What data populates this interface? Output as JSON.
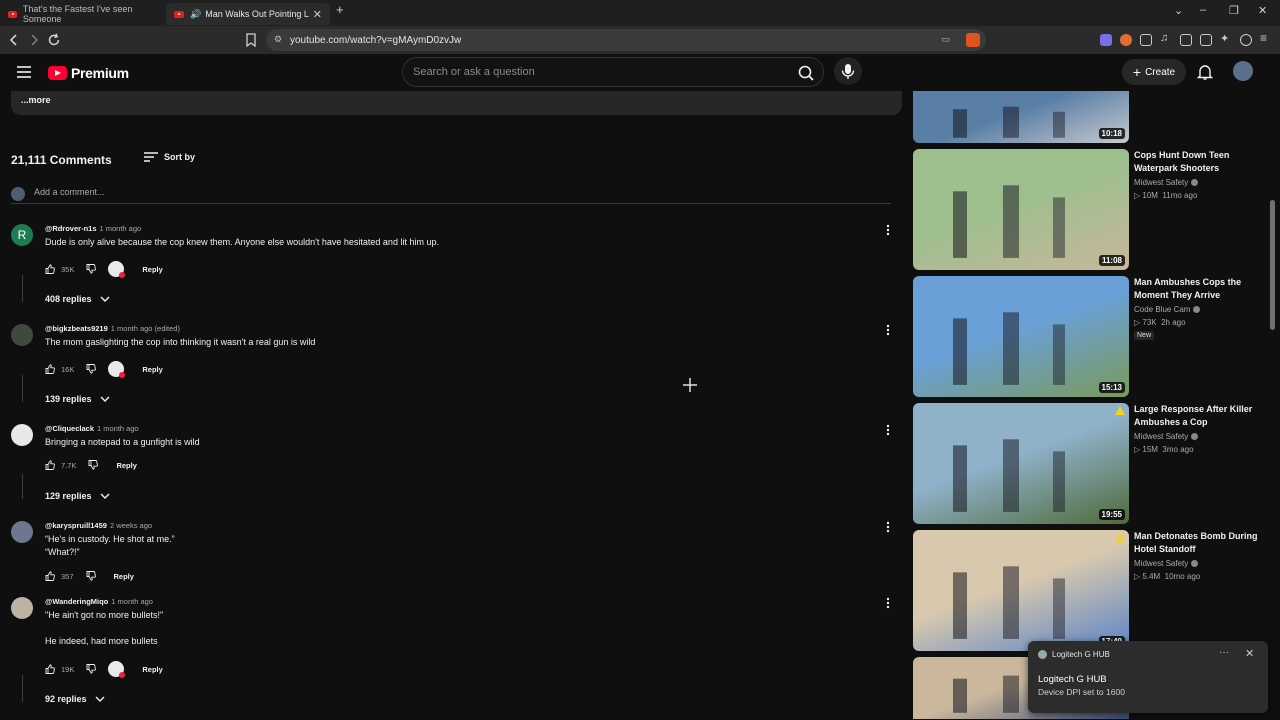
{
  "browser": {
    "tabs": [
      {
        "title": "That's the Fastest I've seen Someone"
      },
      {
        "title": "Man Walks Out Pointing Load"
      }
    ],
    "url": "youtube.com/watch?v=gMAymD0zvJw"
  },
  "header": {
    "logo": "Premium",
    "search_placeholder": "Search or ask a question",
    "create_label": "Create"
  },
  "description": {
    "more_label": "...more"
  },
  "comments": {
    "count_label": "21,111 Comments",
    "sort_label": "Sort by",
    "add_placeholder": "Add a comment...",
    "reply_label": "Reply",
    "items": [
      {
        "avatar_letter": "R",
        "avatar_color": "#1e7c53",
        "handle": "@Rdrover-n1s",
        "time": "1 month ago",
        "lines": [
          "Dude is only alive because the cop knew them.  Anyone else wouldn't have hesitated and lit him up."
        ],
        "likes": "35K",
        "creator_heart": true,
        "replies": "408 replies"
      },
      {
        "avatar_letter": "",
        "avatar_color": "#3f4a3c",
        "handle": "@bigkzbeats9219",
        "time": "1 month ago (edited)",
        "lines": [
          "The mom gaslighting the cop into thinking it wasn't a real gun is wild"
        ],
        "likes": "16K",
        "creator_heart": true,
        "replies": "139 replies"
      },
      {
        "avatar_letter": "",
        "avatar_color": "#e8e8e8",
        "handle": "@Cliqueclack",
        "time": "1 month ago",
        "lines": [
          "Bringing a notepad to a gunfight is wild"
        ],
        "likes": "7.7K",
        "creator_heart": false,
        "replies": "129 replies"
      },
      {
        "avatar_letter": "",
        "avatar_color": "#6d7890",
        "handle": "@karyspruill1459",
        "time": "2 weeks ago",
        "lines": [
          "“He's in custody. He shot at me.”",
          "“What?!”"
        ],
        "likes": "357",
        "creator_heart": false,
        "replies": ""
      },
      {
        "avatar_letter": "",
        "avatar_color": "#bdb3a4",
        "handle": "@WanderingMiqo",
        "time": "1 month ago",
        "lines": [
          "\"He ain't got no more bullets!\"",
          "",
          "He indeed, had more bullets"
        ],
        "likes": "19K",
        "creator_heart": true,
        "replies": "92 replies"
      }
    ]
  },
  "recommendations": [
    {
      "duration": "10:18",
      "title": "",
      "channel": "",
      "views": "",
      "age": "",
      "is_new": false,
      "warning": false,
      "thumb_colors": [
        "#5a7fa6",
        "#c7c9cf"
      ]
    },
    {
      "duration": "11:08",
      "title": "Cops Hunt Down Teen Waterpark Shooters",
      "channel": "Midwest Safety",
      "views": "10M",
      "age": "11mo ago",
      "is_new": false,
      "warning": false,
      "thumb_colors": [
        "#9dbf8e",
        "#c8b79a"
      ]
    },
    {
      "duration": "15:13",
      "title": "Man Ambushes Cops the Moment They Arrive",
      "channel": "Code Blue Cam",
      "views": "73K",
      "age": "2h ago",
      "is_new": true,
      "new_label": "New",
      "warning": false,
      "thumb_colors": [
        "#6aa0d8",
        "#7a9a5a"
      ]
    },
    {
      "duration": "19:55",
      "title": "Large Response After Killer Ambushes a Cop",
      "channel": "Midwest Safety",
      "views": "15M",
      "age": "3mo ago",
      "is_new": false,
      "warning": true,
      "thumb_colors": [
        "#8fb1c9",
        "#4f6a3a"
      ]
    },
    {
      "duration": "17:49",
      "title": "Man Detonates Bomb During Hotel Standoff",
      "channel": "Midwest Safety",
      "views": "5.4M",
      "age": "10mo ago",
      "is_new": false,
      "warning": true,
      "thumb_colors": [
        "#d8c9ae",
        "#5a83c7"
      ]
    },
    {
      "duration": "",
      "title": "",
      "channel": "",
      "views": "",
      "age": "",
      "is_new": false,
      "warning": false,
      "thumb_colors": [
        "#cbb79c",
        "#3d4f7a"
      ]
    }
  ],
  "toast": {
    "app": "Logitech G HUB",
    "title": "Logitech G HUB",
    "message": "Device DPI set to 1600"
  }
}
